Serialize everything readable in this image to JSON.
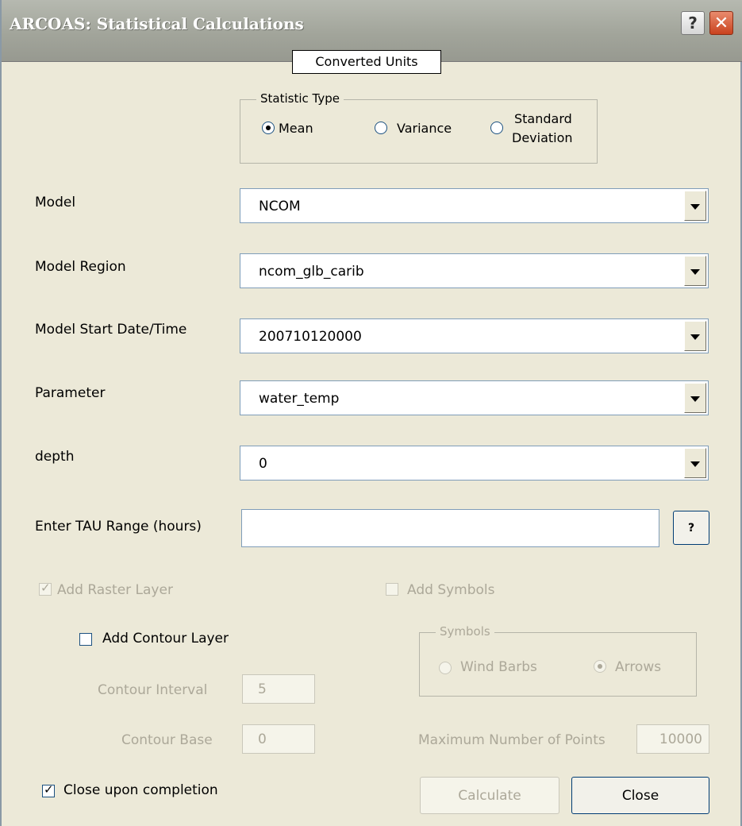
{
  "window": {
    "title": "ARCOAS:  Statistical Calculations",
    "help_label": "?",
    "close_label": "✕"
  },
  "units_label": "Converted Units",
  "statistic_type": {
    "legend": "Statistic Type",
    "options": [
      {
        "label": "Mean",
        "selected": true
      },
      {
        "label": "Variance",
        "selected": false
      },
      {
        "label_line1": "Standard",
        "label_line2": "Deviation",
        "selected": false
      }
    ]
  },
  "fields": {
    "model": {
      "label": "Model",
      "value": "NCOM"
    },
    "model_region": {
      "label": "Model Region",
      "value": "ncom_glb_carib"
    },
    "model_start": {
      "label": "Model Start Date/Time",
      "value": "200710120000"
    },
    "parameter": {
      "label": "Parameter",
      "value": "water_temp"
    },
    "depth": {
      "label": "depth",
      "value": "0"
    },
    "tau_range": {
      "label": "Enter TAU Range (hours)",
      "value": "",
      "help_label": "?"
    }
  },
  "options": {
    "add_raster_layer": {
      "label": "Add Raster Layer",
      "checked": true,
      "enabled": false
    },
    "add_symbols": {
      "label": "Add Symbols",
      "checked": false,
      "enabled": false
    },
    "add_contour_layer": {
      "label": "Add Contour Layer",
      "checked": false,
      "enabled": true
    },
    "contour_interval": {
      "label": "Contour Interval",
      "value": "5"
    },
    "contour_base": {
      "label": "Contour Base",
      "value": "0"
    },
    "close_upon_completion": {
      "label": "Close upon completion",
      "checked": true
    }
  },
  "symbols": {
    "legend": "Symbols",
    "wind_barbs": {
      "label": "Wind Barbs",
      "selected": false
    },
    "arrows": {
      "label": "Arrows",
      "selected": true
    },
    "max_points_label": "Maximum Number of Points",
    "max_points_value": "10000"
  },
  "buttons": {
    "calculate": "Calculate",
    "close": "Close"
  }
}
